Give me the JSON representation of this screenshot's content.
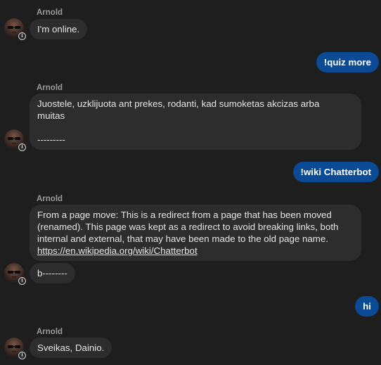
{
  "messages": {
    "m1": {
      "sender": "Arnold",
      "text": "I'm online."
    },
    "m2": {
      "text": "!quiz more"
    },
    "m3": {
      "sender": "Arnold",
      "line1": "Juostele, uzklijuota ant prekes, rodanti, kad sumoketas akcizas arba",
      "line2": "muitas",
      "line3": "---------"
    },
    "m4": {
      "text": "!wiki Chatterbot"
    },
    "m5": {
      "sender": "Arnold",
      "line1": "From a page move: This is a redirect from a page that has been moved",
      "line2": "(renamed). This page was kept as a redirect to avoid breaking links, both",
      "line3": "internal and external, that may have been made to the old page name.",
      "link": "https://en.wikipedia.org/wiki/Chatterbot"
    },
    "m6": {
      "text": "b--------"
    },
    "m7": {
      "text": "hi"
    },
    "m8": {
      "sender": "Arnold",
      "text": "Sveikas, Dainio."
    }
  },
  "colors": {
    "background": "#1e1e1e",
    "incoming_bubble": "#2d2d2d",
    "outgoing_bubble": "#0b4a94",
    "sender_name": "#9a9a9a"
  },
  "icons": {
    "avatar": "user-avatar-sunglasses",
    "badge": "info-badge-icon"
  }
}
